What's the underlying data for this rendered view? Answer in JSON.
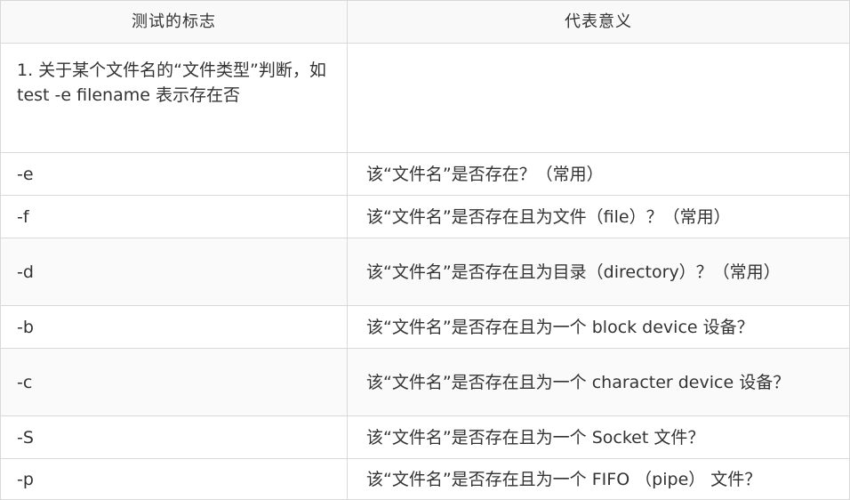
{
  "table": {
    "headers": [
      "测试的标志",
      "代表意义"
    ],
    "section_title": "1. 关于某个文件名的“文件类型”判断，如 test -e filename 表示存在否",
    "rows": [
      {
        "flag": "-e",
        "meaning": "该“文件名”是否存在？（常用）"
      },
      {
        "flag": "-f",
        "meaning": "该“文件名”是否存在且为文件（file）？（常用）"
      },
      {
        "flag": "-d",
        "meaning": "该“文件名”是否存在且为目录（directory）？（常用）"
      },
      {
        "flag": "-b",
        "meaning": "该“文件名”是否存在且为一个 block device 设备？"
      },
      {
        "flag": "-c",
        "meaning": "该“文件名”是否存在且为一个 character device 设备？"
      },
      {
        "flag": "-S",
        "meaning": "该“文件名”是否存在且为一个 Socket 文件？"
      },
      {
        "flag": "-p",
        "meaning": "该“文件名”是否存在且为一个 FIFO （pipe） 文件？"
      }
    ]
  }
}
